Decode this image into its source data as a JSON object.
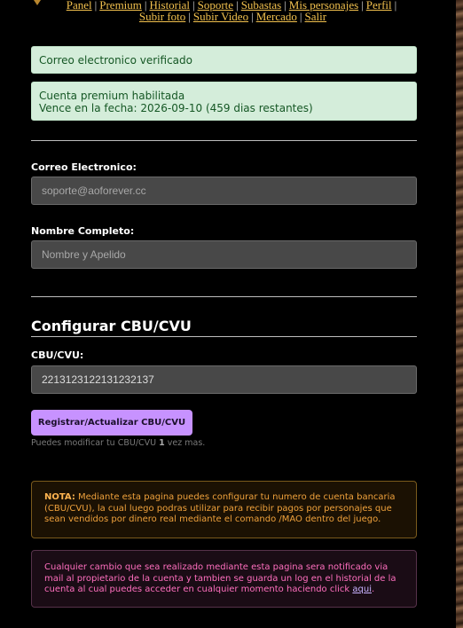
{
  "nav": {
    "row1": [
      "Panel",
      "Premium",
      "Historial",
      "Soporte",
      "Subastas",
      "Mis personajes",
      "Perfil"
    ],
    "row2": [
      "Subir foto",
      "Subir Video",
      "Mercado",
      "Salir"
    ],
    "separator": "|"
  },
  "alerts": {
    "email_verified": "Correo electronico verificado",
    "premium_line1": "Cuenta premium habilitada",
    "premium_line2": "Vence en la fecha: 2026-09-10 (459 dias restantes)"
  },
  "form": {
    "email_label": "Correo Electronico:",
    "email_placeholder": "soporte@aoforever.cc",
    "name_label": "Nombre Completo:",
    "name_placeholder": "Nombre y Apelido"
  },
  "cbu": {
    "title": "Configurar CBU/CVU",
    "label": "CBU/CVU:",
    "value": "2213123122131232137",
    "button": "Registrar/Actualizar CBU/CVU",
    "hint_prefix": "Puedes modificar tu CBU/CVU ",
    "hint_count": "1",
    "hint_suffix": " vez mas."
  },
  "note": {
    "label": "NOTA:",
    "text": " Mediante esta pagina puedes configurar tu numero de cuenta bancaria (CBU/CVU), la cual luego podras utilizar para recibir pagos por personajes que sean vendidos por dinero real mediante el comando /MAO dentro del juego."
  },
  "warning": {
    "text": "Cualquier cambio que sea realizado mediante esta pagina sera notificado via mail al propietario de la cuenta y tambien se guarda un log en el historial de la cuenta al cual puedes acceder en cualquier momento haciendo click ",
    "link": "aqui",
    "end": "."
  },
  "colors": {
    "accent_link": "#f2c14e",
    "button": "#c792ff",
    "success_bg": "#d4edda",
    "note_text": "#f0a23c",
    "warning_text": "#ff6fbf"
  }
}
